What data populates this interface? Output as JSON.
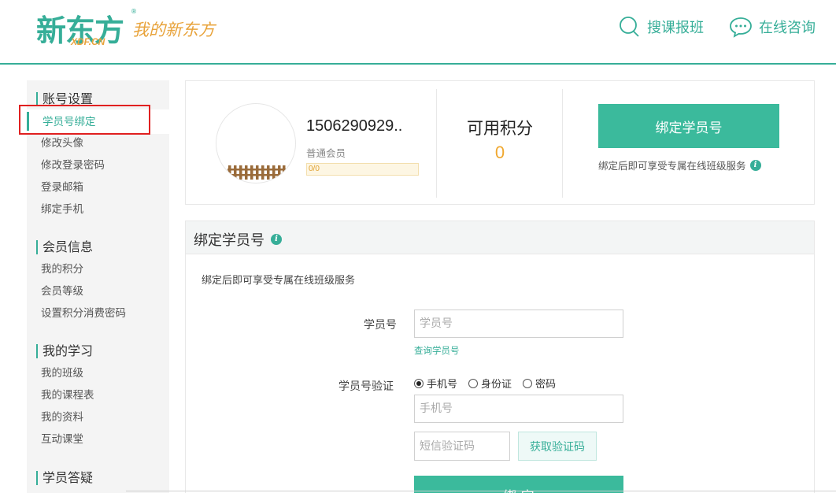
{
  "header": {
    "logo_text": "新东方",
    "logo_sub": "XDF.CN",
    "logo_reg": "®",
    "logo_tagline": "我的新东方",
    "search_label": "搜课报班",
    "consult_label": "在线咨询"
  },
  "sidebar": {
    "groups": [
      {
        "title": "账号设置",
        "items": [
          "学员号绑定",
          "修改头像",
          "修改登录密码",
          "登录邮箱",
          "绑定手机"
        ]
      },
      {
        "title": "会员信息",
        "items": [
          "我的积分",
          "会员等级",
          "设置积分消费密码"
        ]
      },
      {
        "title": "我的学习",
        "items": [
          "我的班级",
          "我的课程表",
          "我的资料",
          "互动课堂"
        ]
      },
      {
        "title": "学员答疑",
        "items": []
      }
    ],
    "active_item": "学员号绑定"
  },
  "profile": {
    "username": "1506290929..",
    "member_level": "普通会员",
    "progress_text": "0/0",
    "progress_value": 0,
    "points_title": "可用积分",
    "points_value": "0",
    "bind_button": "绑定学员号",
    "bind_note": "绑定后即可享受专属在线班级服务",
    "info_glyph": "i"
  },
  "bind_panel": {
    "title": "绑定学员号",
    "description": "绑定后即可享受专属在线班级服务",
    "student_id_label": "学员号",
    "student_id_placeholder": "学员号",
    "query_link": "查询学员号",
    "verify_label": "学员号验证",
    "verify_options": [
      {
        "label": "手机号",
        "checked": true
      },
      {
        "label": "身份证",
        "checked": false
      },
      {
        "label": "密码",
        "checked": false
      }
    ],
    "phone_placeholder": "手机号",
    "sms_placeholder": "短信验证码",
    "sms_button": "获取验证码",
    "submit_button": "绑 定"
  },
  "colors": {
    "brand": "#36ae98",
    "button": "#3bba9c",
    "accent": "#f0a830",
    "highlight": "#e02020"
  }
}
